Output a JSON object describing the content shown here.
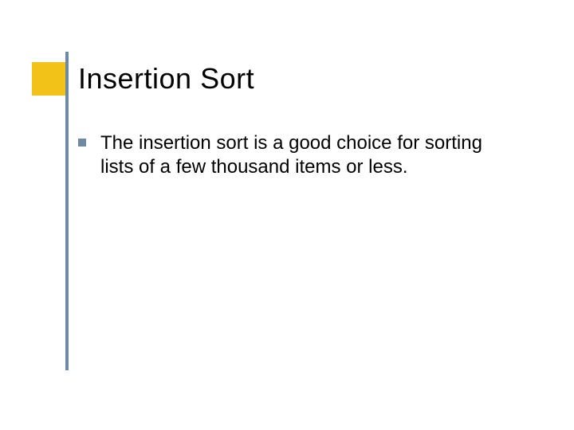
{
  "slide": {
    "title": "Insertion Sort",
    "bullets": [
      "The insertion sort is a good choice for sorting lists of a few thousand items or less."
    ]
  },
  "theme": {
    "accent_square": "#f2c218",
    "accent_line": "#6e8aa3",
    "bullet_color": "#6e8aa3"
  }
}
